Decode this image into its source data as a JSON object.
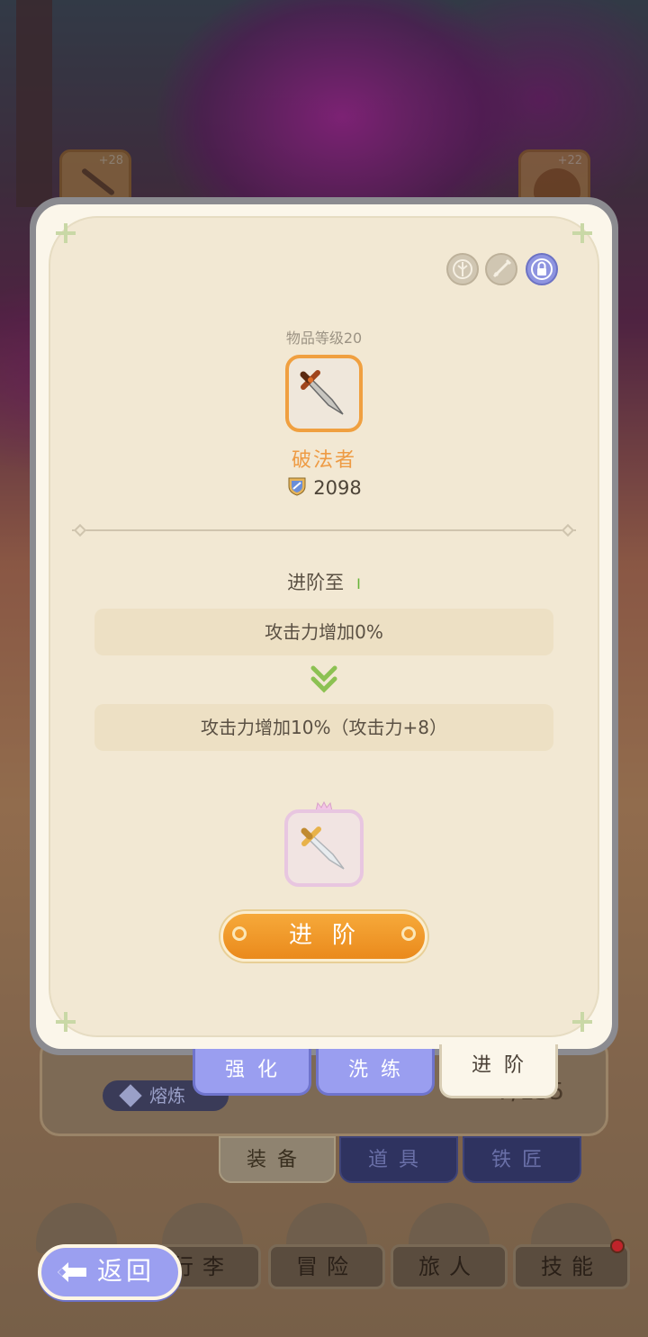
{
  "background": {
    "slot_left_plus": "+28",
    "slot_right_plus": "+22",
    "smelt_label": "熔炼",
    "count_text": "7/135",
    "lower_tabs": [
      {
        "label": "装备",
        "active": true
      },
      {
        "label": "道具",
        "active": false
      },
      {
        "label": "铁匠",
        "active": false
      }
    ],
    "nav": [
      {
        "label": "行李",
        "icon": "bag-icon"
      },
      {
        "label": "冒险",
        "icon": "crossed-swords-icon"
      },
      {
        "label": "旅人",
        "icon": "hooded-figure-icon"
      },
      {
        "label": "技能",
        "icon": "eye-star-icon",
        "badge": true
      }
    ],
    "back_label": "返回"
  },
  "dialog": {
    "top_icons": [
      "crest-icon",
      "sword-icon",
      "lock-icon"
    ],
    "item_level": "物品等级20",
    "item_name": "破法者",
    "power": "2098",
    "advance_to_label": "进阶至",
    "advance_tier": "I",
    "current_stat": "攻击力增加0%",
    "next_stat": "攻击力增加10%（攻击力+8）",
    "advance_button": "进阶",
    "tabs": [
      {
        "label": "强化",
        "active": false
      },
      {
        "label": "洗练",
        "active": false
      },
      {
        "label": "进阶",
        "active": true
      }
    ]
  },
  "colors": {
    "item_name": "#ee9b44",
    "advance_button": "#f3a030",
    "tab_inactive": "#9a9ef0",
    "tier": "#67b33a"
  }
}
